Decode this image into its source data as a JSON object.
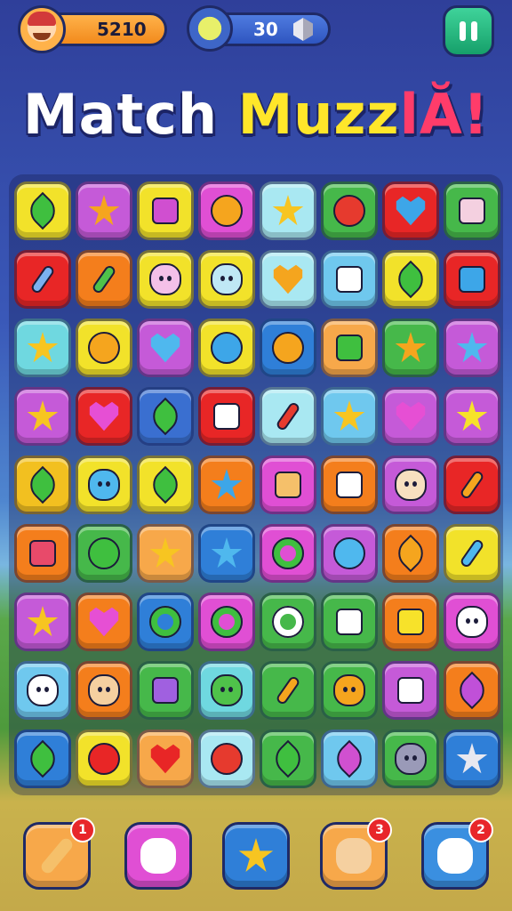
{
  "hud": {
    "coins": "5210",
    "moves": "30"
  },
  "title": {
    "part1": "Match ",
    "part2": "Muzz",
    "part3": "lĂ!"
  },
  "board": {
    "rows": [
      [
        {
          "color": "#f2e22a",
          "shape": "leaf",
          "fill": "#3fbf3f"
        },
        {
          "color": "#c55ad8",
          "shape": "star",
          "fill": "#f5a51e"
        },
        {
          "color": "#f2e22a",
          "shape": "square",
          "fill": "#d04fd0"
        },
        {
          "color": "#e04fd4",
          "shape": "circle",
          "fill": "#f5a51e"
        },
        {
          "color": "#a9e8f2",
          "shape": "star",
          "fill": "#f7c521"
        },
        {
          "color": "#46b84a",
          "shape": "circle",
          "fill": "#e63a2e"
        },
        {
          "color": "#e82626",
          "shape": "heart",
          "fill": "#3da6e8"
        },
        {
          "color": "#46b84a",
          "shape": "square",
          "fill": "#f4d0e0"
        }
      ],
      [
        {
          "color": "#e82626",
          "shape": "bar",
          "fill": "#7bb0f0"
        },
        {
          "color": "#f47e1c",
          "shape": "bar",
          "fill": "#4fc24a"
        },
        {
          "color": "#f2e22a",
          "shape": "face",
          "fill": "#f4c0e8"
        },
        {
          "color": "#f2e22a",
          "shape": "face",
          "fill": "#bfe8f5"
        },
        {
          "color": "#a9e8f2",
          "shape": "heart",
          "fill": "#f5a51e"
        },
        {
          "color": "#6fc8ee",
          "shape": "square",
          "fill": "#ffffff"
        },
        {
          "color": "#f2e22a",
          "shape": "leaf",
          "fill": "#3fbf3f"
        },
        {
          "color": "#e82626",
          "shape": "square",
          "fill": "#3da6e8"
        }
      ],
      [
        {
          "color": "#6fd8e0",
          "shape": "star",
          "fill": "#f7c521"
        },
        {
          "color": "#f2e22a",
          "shape": "circle",
          "fill": "#f5a51e"
        },
        {
          "color": "#c55ad8",
          "shape": "heart",
          "fill": "#4fb8ee"
        },
        {
          "color": "#f2e22a",
          "shape": "circle",
          "fill": "#3da6e8"
        },
        {
          "color": "#2f7fd8",
          "shape": "circle",
          "fill": "#f5a51e"
        },
        {
          "color": "#f7a84a",
          "shape": "square",
          "fill": "#3fbf3f"
        },
        {
          "color": "#46b84a",
          "shape": "burst",
          "fill": "#f5a51e"
        },
        {
          "color": "#c55ad8",
          "shape": "star",
          "fill": "#4fb8ee"
        }
      ],
      [
        {
          "color": "#c55ad8",
          "shape": "star",
          "fill": "#f7c521"
        },
        {
          "color": "#e82626",
          "shape": "heart",
          "fill": "#e64fd4"
        },
        {
          "color": "#3a6fd0",
          "shape": "leaf",
          "fill": "#3fbf3f"
        },
        {
          "color": "#e82626",
          "shape": "square",
          "fill": "#ffffff"
        },
        {
          "color": "#a9e8f2",
          "shape": "bar",
          "fill": "#e63a2e"
        },
        {
          "color": "#6fc8ee",
          "shape": "star",
          "fill": "#f7c521"
        },
        {
          "color": "#c55ad8",
          "shape": "heart",
          "fill": "#e64fd4"
        },
        {
          "color": "#c55ad8",
          "shape": "star",
          "fill": "#f7e22a"
        }
      ],
      [
        {
          "color": "#f2c020",
          "shape": "leaf",
          "fill": "#3fbf3f"
        },
        {
          "color": "#f2e22a",
          "shape": "face",
          "fill": "#4fb8ee"
        },
        {
          "color": "#f2e22a",
          "shape": "leaf",
          "fill": "#3fbf3f"
        },
        {
          "color": "#f47e1c",
          "shape": "star",
          "fill": "#3da6e8"
        },
        {
          "color": "#e04fd4",
          "shape": "square",
          "fill": "#f5c06a"
        },
        {
          "color": "#f47e1c",
          "shape": "square",
          "fill": "#ffffff"
        },
        {
          "color": "#c55ad8",
          "shape": "face",
          "fill": "#f7e0c0"
        },
        {
          "color": "#e82626",
          "shape": "bar",
          "fill": "#f5a51e"
        }
      ],
      [
        {
          "color": "#f47e1c",
          "shape": "square",
          "fill": "#e84a6a"
        },
        {
          "color": "#46b84a",
          "shape": "circle",
          "fill": "#3fbf3f"
        },
        {
          "color": "#f7a84a",
          "shape": "star",
          "fill": "#f7c521"
        },
        {
          "color": "#2f7fd8",
          "shape": "star",
          "fill": "#4fb8ee"
        },
        {
          "color": "#e04fd4",
          "shape": "ring",
          "fill": "#3fbf3f"
        },
        {
          "color": "#c55ad8",
          "shape": "circle",
          "fill": "#4fb8ee"
        },
        {
          "color": "#f47e1c",
          "shape": "leaf",
          "fill": "#f5a51e"
        },
        {
          "color": "#f2e22a",
          "shape": "bar",
          "fill": "#4fb8ee"
        }
      ],
      [
        {
          "color": "#c55ad8",
          "shape": "star",
          "fill": "#f7c521"
        },
        {
          "color": "#f47e1c",
          "shape": "heart",
          "fill": "#e64fd4"
        },
        {
          "color": "#2f7fd8",
          "shape": "ring",
          "fill": "#3fbf3f"
        },
        {
          "color": "#e04fd4",
          "shape": "ring",
          "fill": "#3fbf3f"
        },
        {
          "color": "#46b84a",
          "shape": "ring",
          "fill": "#ffffff"
        },
        {
          "color": "#46b84a",
          "shape": "square",
          "fill": "#ffffff"
        },
        {
          "color": "#f47e1c",
          "shape": "square",
          "fill": "#f7e22a"
        },
        {
          "color": "#e04fd4",
          "shape": "face",
          "fill": "#ffffff"
        }
      ],
      [
        {
          "color": "#6fc8ee",
          "shape": "face",
          "fill": "#ffffff"
        },
        {
          "color": "#f47e1c",
          "shape": "face",
          "fill": "#f5d0a0"
        },
        {
          "color": "#46b84a",
          "shape": "square",
          "fill": "#a060e0"
        },
        {
          "color": "#6fd8e0",
          "shape": "face",
          "fill": "#4fc24a"
        },
        {
          "color": "#46b84a",
          "shape": "bar",
          "fill": "#f5a51e"
        },
        {
          "color": "#46b84a",
          "shape": "face",
          "fill": "#f5a51e"
        },
        {
          "color": "#c55ad8",
          "shape": "square",
          "fill": "#ffffff"
        },
        {
          "color": "#f47e1c",
          "shape": "leaf",
          "fill": "#c050d8"
        }
      ],
      [
        {
          "color": "#2f7fd8",
          "shape": "leaf",
          "fill": "#3fbf3f"
        },
        {
          "color": "#f2e22a",
          "shape": "circle",
          "fill": "#e82626"
        },
        {
          "color": "#f7a84a",
          "shape": "heart",
          "fill": "#e82626"
        },
        {
          "color": "#a9e8f2",
          "shape": "circle",
          "fill": "#e63a2e"
        },
        {
          "color": "#46b84a",
          "shape": "leaf",
          "fill": "#3fbf3f"
        },
        {
          "color": "#6fc8ee",
          "shape": "leaf",
          "fill": "#d050d0"
        },
        {
          "color": "#46b84a",
          "shape": "face",
          "fill": "#9a9ab8"
        },
        {
          "color": "#2f7fd8",
          "shape": "star",
          "fill": "#e8e8f0"
        }
      ]
    ]
  },
  "boosters": [
    {
      "name": "booster-hammer",
      "color": "#f7a84a",
      "fill": "#f5c06a",
      "count": "1"
    },
    {
      "name": "booster-cloud",
      "color": "#e04fd4",
      "fill": "#ffffff",
      "count": ""
    },
    {
      "name": "booster-star",
      "color": "#2f7fd8",
      "fill": "#f7c521",
      "count": ""
    },
    {
      "name": "booster-bird",
      "color": "#f7a84a",
      "fill": "#f5d0a0",
      "count": "3"
    },
    {
      "name": "booster-swirl",
      "color": "#3a8fe0",
      "fill": "#ffffff",
      "count": "2"
    }
  ]
}
